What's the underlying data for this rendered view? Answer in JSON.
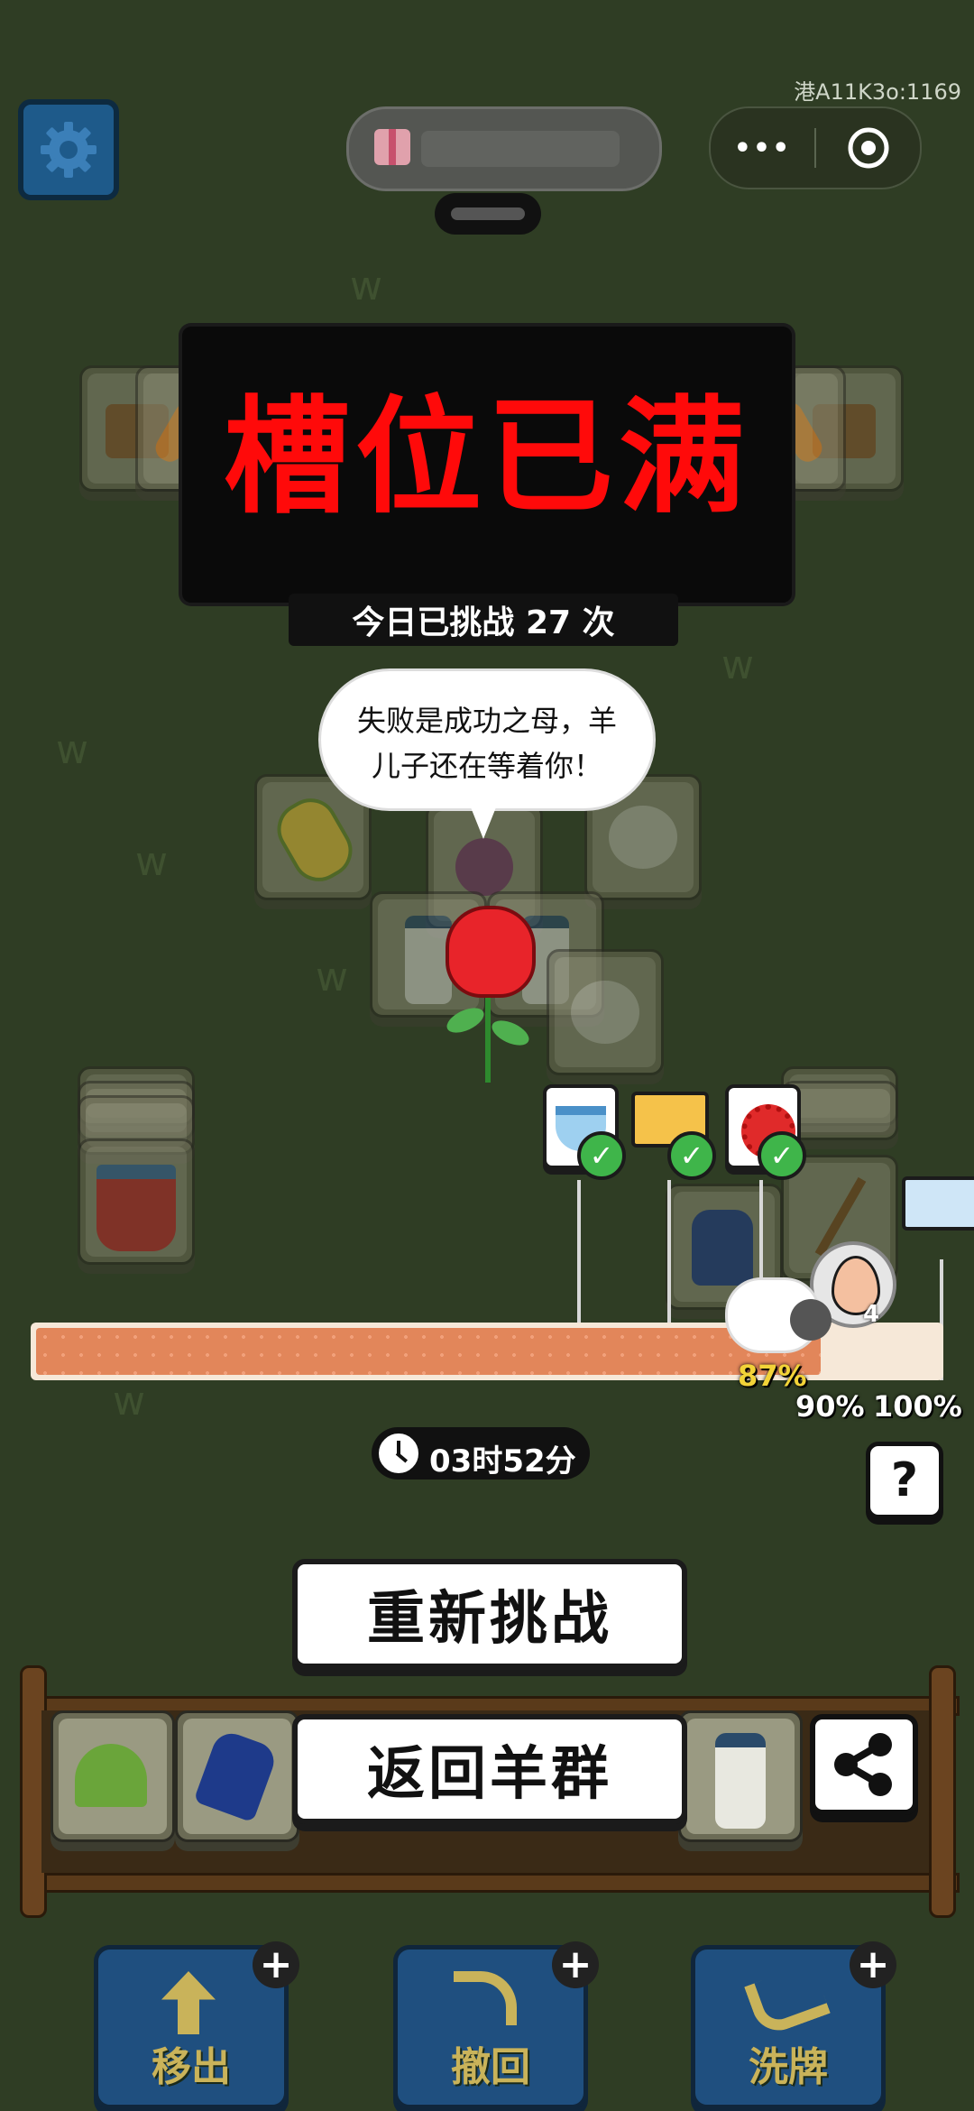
{
  "header": {
    "room_id": "港A11K3o:1169",
    "mini_program_pill": "",
    "menu_dots": "•••"
  },
  "banner": {
    "title": "槽位已满",
    "challenge_count_text": "今日已挑战 27 次"
  },
  "speech_bubble": {
    "line1": "失败是成功之母，羊",
    "line2": "儿子还在等着你！"
  },
  "progress": {
    "current_percent": 0.87,
    "current_label": "87%",
    "milestone_90": "90%",
    "milestone_100": "100%",
    "egg_count": "4"
  },
  "timer": {
    "value": "03时52分"
  },
  "help": {
    "label": "?"
  },
  "buttons": {
    "retry": "重新挑战",
    "back_to_flock": "返回羊群"
  },
  "tools": [
    {
      "label": "移出",
      "icon": "move-out-icon"
    },
    {
      "label": "撤回",
      "icon": "undo-icon"
    },
    {
      "label": "洗牌",
      "icon": "shuffle-icon"
    }
  ],
  "colors": {
    "background": "#2f3d24",
    "banner_text": "#ff0000",
    "progress_bar": "#e2865a",
    "tool_button": "#1f4f7f"
  }
}
